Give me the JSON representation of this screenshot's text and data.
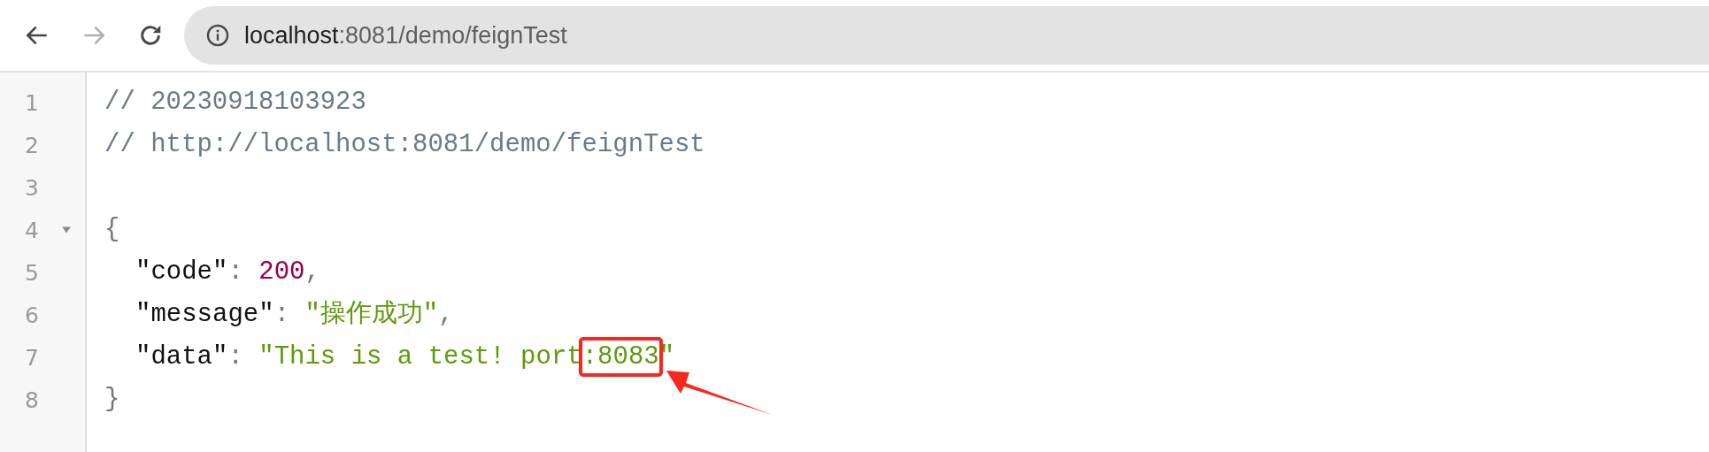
{
  "toolbar": {
    "back": {
      "disabled": false
    },
    "forward": {
      "disabled": true
    },
    "address": {
      "host": "localhost",
      "path": ":8081/demo/feignTest"
    }
  },
  "code": {
    "lines": [
      {
        "number": "1",
        "tokens": [
          {
            "kind": "comment",
            "text": "// 20230918103923"
          }
        ]
      },
      {
        "number": "2",
        "tokens": [
          {
            "kind": "comment",
            "text": "// http://localhost:8081/demo/feignTest"
          }
        ]
      },
      {
        "number": "3"
      },
      {
        "number": "4",
        "fold": {
          "expanded": true
        },
        "tokens": [
          {
            "kind": "brace",
            "text": "{"
          }
        ]
      },
      {
        "number": "5",
        "indent": true,
        "tokens": [
          {
            "kind": "key",
            "text": "\"code\""
          },
          {
            "kind": "punct",
            "text": ": "
          },
          {
            "kind": "number",
            "text": "200"
          },
          {
            "kind": "punct",
            "text": ","
          }
        ]
      },
      {
        "number": "6",
        "indent": true,
        "tokens": [
          {
            "kind": "key",
            "text": "\"message\""
          },
          {
            "kind": "punct",
            "text": ": "
          },
          {
            "kind": "string",
            "text": "\"操作成功\""
          },
          {
            "kind": "punct",
            "text": ","
          }
        ]
      },
      {
        "number": "7",
        "indent": true,
        "tokens": [
          {
            "kind": "key",
            "text": "\"data\""
          },
          {
            "kind": "punct",
            "text": ": "
          },
          {
            "kind": "string",
            "text": "\"This is a test! port"
          },
          {
            "kind": "string",
            "text": ":8083",
            "highlighted": true
          },
          {
            "kind": "string",
            "text": "\""
          }
        ]
      },
      {
        "number": "8",
        "tokens": [
          {
            "kind": "brace",
            "text": "}"
          }
        ]
      }
    ]
  }
}
